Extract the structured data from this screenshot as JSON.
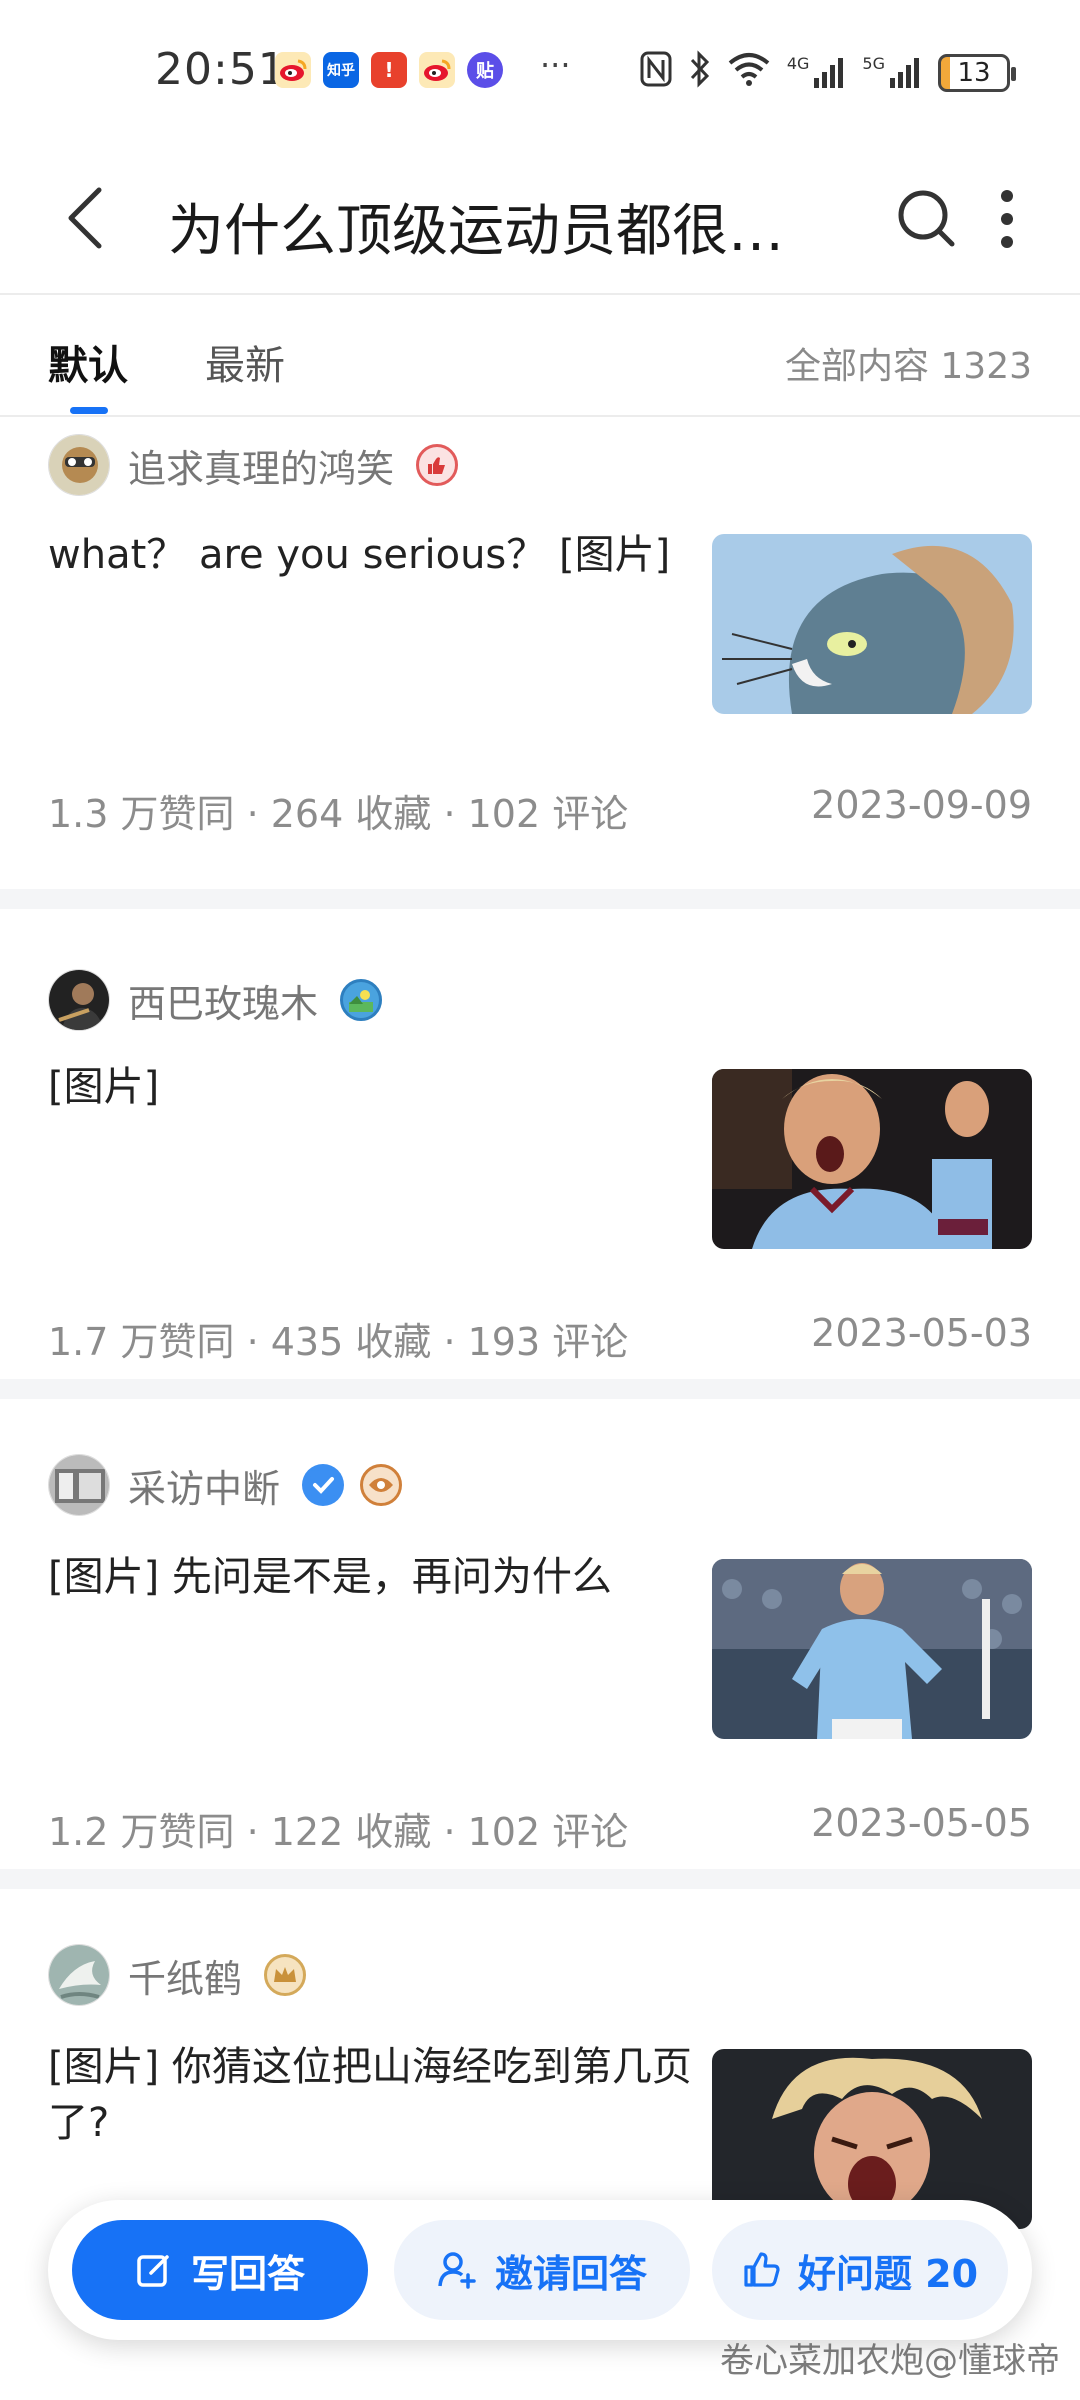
{
  "status_bar": {
    "time": "20:51",
    "overflow": "···",
    "network": [
      "4G",
      "5G"
    ],
    "battery": "13",
    "notification_icons": [
      "weibo-icon",
      "zhihu-icon",
      "notification-icon",
      "weibo-icon",
      "tieba-icon"
    ],
    "zhihu_label": "知乎",
    "tieba_label": "贴",
    "notif_label": "!"
  },
  "header": {
    "title": "为什么顶级运动员都很…"
  },
  "tabs": {
    "items": [
      {
        "label": "默认"
      },
      {
        "label": "最新"
      }
    ],
    "total": "全部内容 1323"
  },
  "answers": [
    {
      "author": "追求真理的鸿笑",
      "badges": [
        "thumbs-up-badge-icon"
      ],
      "excerpt": "what？ are you serious？ [图片]",
      "thumbnail": "cartoon-cat-meme-image",
      "meta": "1.3 万赞同 · 264 收藏 · 102 评论",
      "date": "2023-09-09"
    },
    {
      "author": "西巴玫瑰木",
      "badges": [
        "landscape-badge-icon"
      ],
      "excerpt": "[图片]",
      "thumbnail": "footballer-celebrating-image",
      "meta": "1.7 万赞同 · 435 收藏 · 193 评论",
      "date": "2023-05-03"
    },
    {
      "author": "采访中断",
      "badges": [
        "verified-badge-icon",
        "eye-badge-icon"
      ],
      "excerpt": "[图片] 先问是不是，再问为什么",
      "thumbnail": "footballer-shouting-image",
      "meta": "1.2 万赞同 · 122 收藏 · 102 评论",
      "date": "2023-05-05"
    },
    {
      "author": "千纸鹤",
      "badges": [
        "crown-badge-icon"
      ],
      "excerpt": "[图片] 你猜这位把山海经吃到第几页了?",
      "thumbnail": "footballer-screaming-image",
      "meta": "",
      "date": ""
    }
  ],
  "actions": {
    "write": "写回答",
    "invite": "邀请回答",
    "good_question": "好问题 20"
  },
  "watermark": "卷心菜加农炮@懂球帝",
  "colors": {
    "accent": "#1772f6",
    "meta_text": "#8c8c8c",
    "separator": "#f4f5f7"
  }
}
